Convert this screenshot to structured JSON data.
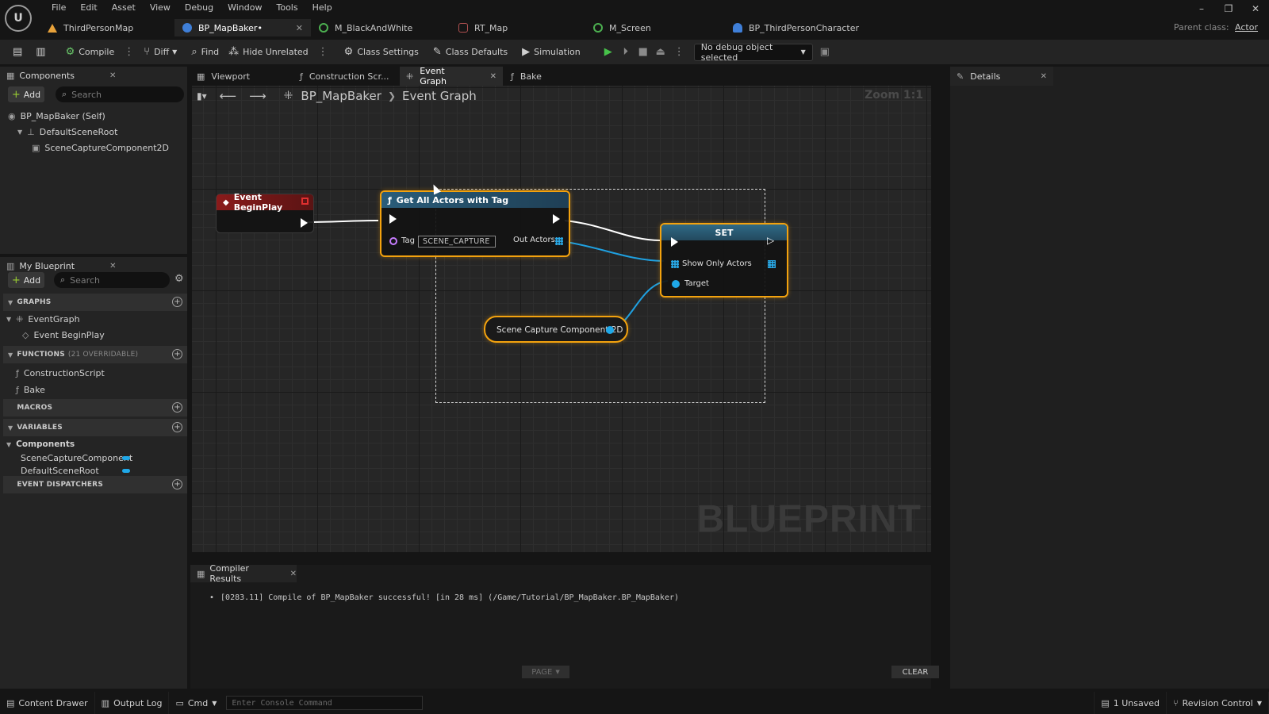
{
  "menu": [
    "File",
    "Edit",
    "Asset",
    "View",
    "Debug",
    "Window",
    "Tools",
    "Help"
  ],
  "doc_tabs": [
    {
      "label": "ThirdPersonMap",
      "color": "#e8a23a"
    },
    {
      "label": "BP_MapBaker•",
      "color": "#3f7fd8",
      "active": true
    },
    {
      "label": "M_BlackAndWhite",
      "color": "#4caf50"
    },
    {
      "label": "RT_Map",
      "color": "#b05050"
    },
    {
      "label": "M_Screen",
      "color": "#4caf50"
    },
    {
      "label": "BP_ThirdPersonCharacter",
      "color": "#3f7fd8"
    }
  ],
  "parent_class": {
    "label": "Parent class:",
    "value": "Actor"
  },
  "toolbar": {
    "compile": "Compile",
    "diff": "Diff",
    "find": "Find",
    "hide_unrelated": "Hide Unrelated",
    "class_settings": "Class Settings",
    "class_defaults": "Class Defaults",
    "simulation": "Simulation",
    "debug_object": "No debug object selected"
  },
  "components_panel": {
    "title": "Components",
    "add": "Add",
    "search_placeholder": "Search",
    "tree": [
      "BP_MapBaker (Self)",
      "DefaultSceneRoot",
      "SceneCaptureComponent2D"
    ]
  },
  "my_blueprint": {
    "title": "My Blueprint",
    "add": "Add",
    "search_placeholder": "Search",
    "graphs_label": "GRAPHS",
    "event_graph": "EventGraph",
    "event_beginplay": "Event BeginPlay",
    "functions_label": "FUNCTIONS",
    "functions_overridable": "(21 OVERRIDABLE)",
    "functions": [
      "ConstructionScript",
      "Bake"
    ],
    "macros_label": "MACROS",
    "variables_label": "VARIABLES",
    "components_cat": "Components",
    "variables": [
      "SceneCaptureComponent",
      "DefaultSceneRoot"
    ],
    "dispatchers_label": "EVENT DISPATCHERS"
  },
  "graph_tabs": [
    "Viewport",
    "Construction Scr...",
    "Event Graph",
    "Bake"
  ],
  "graph": {
    "breadcrumb_root": "BP_MapBaker",
    "breadcrumb_leaf": "Event Graph",
    "zoom": "Zoom 1:1",
    "watermark": "BLUEPRINT",
    "nodes": {
      "begin_play": "Event BeginPlay",
      "get_all_actors": "Get All Actors with Tag",
      "tag_label": "Tag",
      "tag_value": "SCENE_CAPTURE",
      "out_actors": "Out Actors",
      "set_title": "SET",
      "show_only_actors": "Show Only Actors",
      "target": "Target",
      "scene_capture": "Scene Capture Component 2D"
    }
  },
  "compiler": {
    "title": "Compiler Results",
    "message": "[0283.11] Compile of BP_MapBaker successful! [in 28 ms] (/Game/Tutorial/BP_MapBaker.BP_MapBaker)",
    "page": "PAGE",
    "clear": "CLEAR"
  },
  "details": {
    "title": "Details"
  },
  "statusbar": {
    "content_drawer": "Content Drawer",
    "output_log": "Output Log",
    "cmd": "Cmd",
    "console_placeholder": "Enter Console Command",
    "unsaved": "1 Unsaved",
    "revision_control": "Revision Control"
  }
}
